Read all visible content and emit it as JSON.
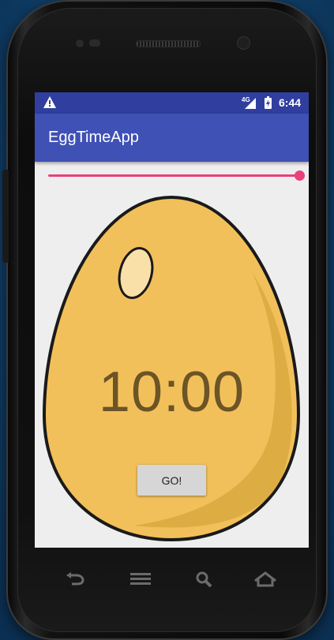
{
  "status_bar": {
    "network": "4G",
    "time": "6:44",
    "icons": [
      "warning-icon",
      "signal-icon",
      "battery-charging-icon"
    ]
  },
  "app_bar": {
    "title": "EggTimeApp"
  },
  "slider": {
    "value": 1.0,
    "min": 0,
    "max": 1,
    "color": "#e94077"
  },
  "timer": {
    "display": "10:00"
  },
  "go_button": {
    "label": "GO!"
  },
  "hardware_keys": [
    "back-icon",
    "menu-icon",
    "search-icon",
    "home-icon"
  ],
  "colors": {
    "status_bar": "#303f9f",
    "app_bar": "#3f51b5",
    "accent": "#ec407a",
    "egg_fill": "#f2c05a",
    "timer_text": "#6b5426"
  }
}
